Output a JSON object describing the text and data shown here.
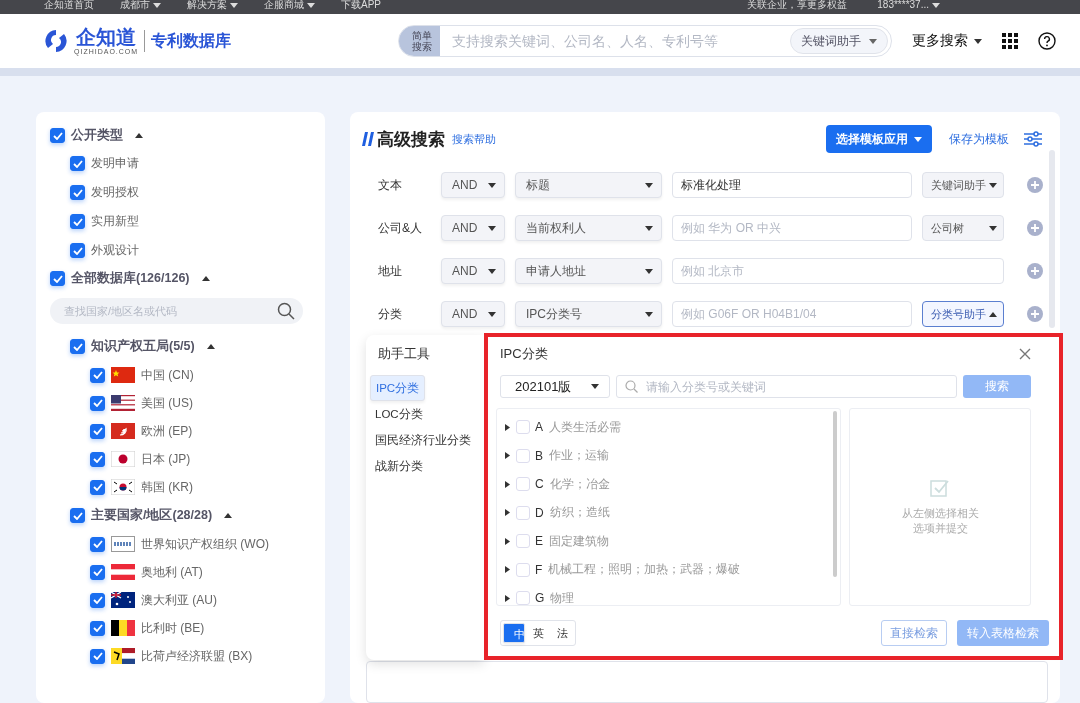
{
  "top_bar": {
    "links": [
      {
        "label": "企知道首页",
        "dropdown": false
      },
      {
        "label": "成都市",
        "dropdown": true
      },
      {
        "label": "解决方案",
        "dropdown": true
      },
      {
        "label": "企服商城",
        "dropdown": true
      },
      {
        "label": "下载APP",
        "dropdown": false
      }
    ],
    "promo": "关联企业，享更多权益",
    "account": "183****37..."
  },
  "header": {
    "brand": "企知道",
    "brand_sub": "QIZHIDAO.COM",
    "product": "专利数据库",
    "mode_toggle": "简单搜索",
    "search_placeholder": "支持搜索关键词、公司名、人名、专利号等",
    "keyword_helper": "关键词助手",
    "more_search": "更多搜索"
  },
  "filters": [
    {
      "label": "公开类型",
      "checked": true,
      "expanded": true,
      "children": [
        {
          "label": "发明申请",
          "checked": true
        },
        {
          "label": "发明授权",
          "checked": true
        },
        {
          "label": "实用新型",
          "checked": true
        },
        {
          "label": "外观设计",
          "checked": true
        }
      ]
    },
    {
      "label": "全部数据库(126/126)",
      "checked": true,
      "expanded": true,
      "search_placeholder": "查找国家/地区名或代码",
      "children": [
        {
          "label": "知识产权五局(5/5)",
          "checked": true,
          "expanded": true,
          "children": [
            {
              "label": "中国 (CN)",
              "checked": true
            },
            {
              "label": "美国 (US)",
              "checked": true
            },
            {
              "label": "欧洲 (EP)",
              "checked": true
            },
            {
              "label": "日本 (JP)",
              "checked": true
            },
            {
              "label": "韩国 (KR)",
              "checked": true
            }
          ]
        },
        {
          "label": "主要国家/地区(28/28)",
          "checked": true,
          "expanded": true,
          "children": [
            {
              "label": "世界知识产权组织 (WO)",
              "checked": true
            },
            {
              "label": "奥地利 (AT)",
              "checked": true
            },
            {
              "label": "澳大利亚 (AU)",
              "checked": true
            },
            {
              "label": "比利时 (BE)",
              "checked": true
            },
            {
              "label": "比荷卢经济联盟 (BX)",
              "checked": true
            }
          ]
        }
      ]
    }
  ],
  "advanced": {
    "title": "高级搜索",
    "help_link": "搜索帮助",
    "template_button": "选择模板应用",
    "save_template": "保存为模板",
    "rows": [
      {
        "label": "文本",
        "operator": "AND",
        "field": "标题",
        "value": "标准化处理",
        "helper": "关键词助手",
        "helper_open": false
      },
      {
        "label": "公司&人",
        "operator": "AND",
        "field": "当前权利人",
        "placeholder": "例如 华为 OR 中兴",
        "helper": "公司树",
        "helper_open": false
      },
      {
        "label": "地址",
        "operator": "AND",
        "field": "申请人地址",
        "placeholder": "例如 北京市"
      },
      {
        "label": "分类",
        "operator": "AND",
        "field": "IPC分类号",
        "placeholder": "例如 G06F OR H04B1/04",
        "helper": "分类号助手",
        "helper_open": true
      }
    ]
  },
  "assistant": {
    "title": "助手工具",
    "tools": [
      {
        "label": "IPC分类",
        "selected": true
      },
      {
        "label": "LOC分类",
        "selected": false
      },
      {
        "label": "国民经济行业分类",
        "selected": false
      },
      {
        "label": "战新分类",
        "selected": false
      }
    ],
    "panel": {
      "title": "IPC分类",
      "version": "202101版",
      "search_placeholder": "请输入分类号或关键词",
      "search_button": "搜索",
      "search_disabled": true,
      "classes": [
        {
          "code": "A",
          "name": "人类生活必需",
          "checked": false
        },
        {
          "code": "B",
          "name": "作业；运输",
          "checked": false
        },
        {
          "code": "C",
          "name": "化学；冶金",
          "checked": false
        },
        {
          "code": "D",
          "name": "纺织；造纸",
          "checked": false
        },
        {
          "code": "E",
          "name": "固定建筑物",
          "checked": false
        },
        {
          "code": "F",
          "name": "机械工程；照明；加热；武器；爆破",
          "checked": false
        },
        {
          "code": "G",
          "name": "物理",
          "checked": false
        }
      ],
      "empty_hint": "从左侧选择相关选项并提交",
      "languages": [
        {
          "label": "中",
          "selected": true
        },
        {
          "label": "英",
          "selected": false
        },
        {
          "label": "法",
          "selected": false
        }
      ],
      "direct_search": "直接检索",
      "table_search": "转入表格检索",
      "table_search_disabled": true,
      "highlighted": true
    }
  }
}
